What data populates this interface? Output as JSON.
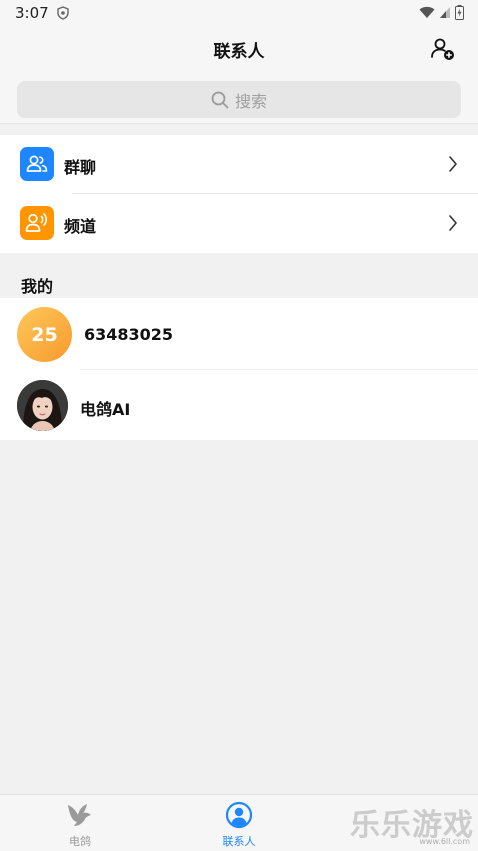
{
  "status_bar": {
    "time": "3:07"
  },
  "header": {
    "title": "联系人"
  },
  "search": {
    "placeholder": "搜索"
  },
  "menu": [
    {
      "label": "群聊",
      "icon": "group-icon",
      "color": "#1e86ff"
    },
    {
      "label": "频道",
      "icon": "channel-icon",
      "color": "#ff9500"
    }
  ],
  "section": {
    "title": "我的"
  },
  "contacts": [
    {
      "avatar_text": "25",
      "name": "63483025"
    },
    {
      "avatar": "portrait-photo",
      "name": "电鸽AI"
    }
  ],
  "tab_bar": {
    "tabs": [
      {
        "label": "电鸽",
        "icon": "pigeon-icon",
        "active": false
      },
      {
        "label": "联系人",
        "icon": "contacts-icon",
        "active": true
      }
    ],
    "active_color": "#1e86ff",
    "inactive_color": "#9a9a9a"
  },
  "watermark": {
    "text": "乐乐游戏",
    "url": "www.6ll.com"
  }
}
